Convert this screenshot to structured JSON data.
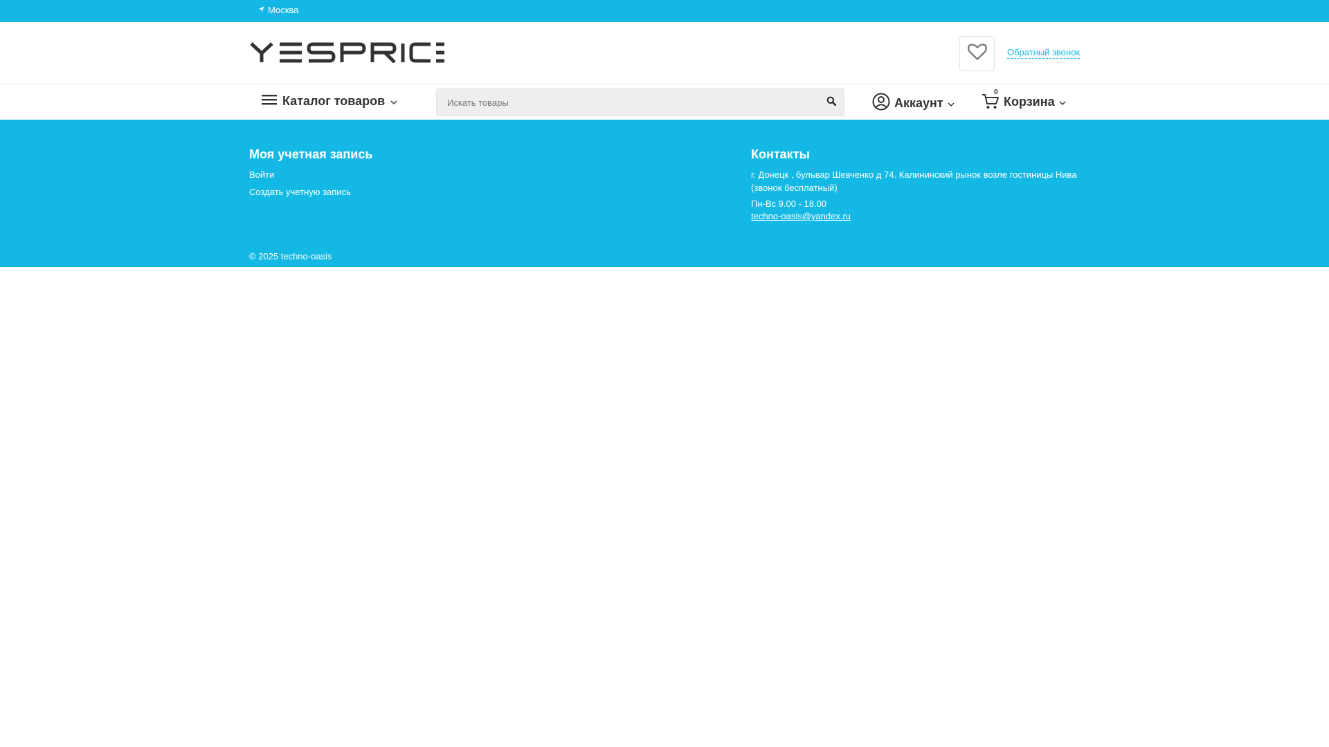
{
  "colors": {
    "accent": "#13b9e4",
    "text_dark": "#333333",
    "search_bg": "#eeeeee"
  },
  "topbar": {
    "city": "Москва",
    "city_icon": "location-arrow-icon"
  },
  "header": {
    "logo_text": "YESPRICE",
    "wishlist_icon": "heart-icon",
    "callback_label": "Обратный звонок"
  },
  "nav": {
    "catalog_label": "Каталог товаров",
    "search": {
      "placeholder": "Искать товары"
    },
    "account_label": "Аккаунт",
    "cart_label": "Корзина",
    "cart_count": "0"
  },
  "footer": {
    "account_title": "Моя учетная запись",
    "account_links": [
      "Войти",
      "Создать учетную запись"
    ],
    "contacts_title": "Контакты",
    "address": "г. Донецк , бульвар Шевченко д 74. Калининский рынок возле гостиницы Нива (звонок бесплатный)",
    "hours": "Пн-Вс 9.00 - 18.00",
    "email": "techno-oasis@yandex.ru",
    "copyright": "© 2025 techno-oasis"
  }
}
